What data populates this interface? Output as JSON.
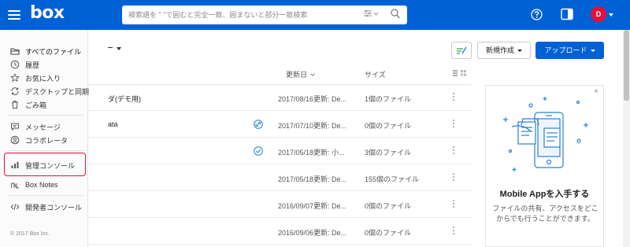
{
  "header": {
    "logo": "box",
    "search_placeholder": "検索語を \" \"で囲むと完全一致、囲まないと部分一致検索",
    "avatar_initial": "D"
  },
  "nav": {
    "items": [
      {
        "label": "すべてのファイル",
        "icon": "folder-icon"
      },
      {
        "label": "履歴",
        "icon": "clock-icon"
      },
      {
        "label": "お気に入り",
        "icon": "star-icon"
      },
      {
        "label": "デスクトップと同期",
        "icon": "sync-icon"
      },
      {
        "label": "ごみ箱",
        "icon": "trash-icon"
      },
      {
        "label": "メッセージ",
        "icon": "message-icon"
      },
      {
        "label": "コラボレータ",
        "icon": "person-icon"
      },
      {
        "label": "管理コンソール",
        "icon": "bar-chart-icon"
      },
      {
        "label": "Box Notes",
        "icon": "notes-icon"
      },
      {
        "label": "開発者コンソール",
        "icon": "code-icon"
      }
    ],
    "copyright": "© 2017 Box Inc."
  },
  "toolbar": {
    "new_label": "新規作成",
    "upload_label": "アップロード"
  },
  "table": {
    "columns": {
      "date": "更新日",
      "size": "サイズ"
    },
    "rows": [
      {
        "name": "ダ(デモ用)",
        "date": "2017/08/16更新: De...",
        "size": "1個のファイル"
      },
      {
        "name": "ata",
        "date": "2017/07/10更新: De...",
        "size": "0個のファイル"
      },
      {
        "name": "",
        "date": "2017/05/18更新: 小...",
        "size": "3個のファイル"
      },
      {
        "name": "",
        "date": "2017/05/18更新: De...",
        "size": "155個のファイル"
      },
      {
        "name": "",
        "date": "2016/09/07更新: De...",
        "size": "0個のファイル"
      },
      {
        "name": "",
        "date": "2016/09/06更新: De...",
        "size": "0個のファイル"
      }
    ]
  },
  "promo": {
    "close": "×",
    "title": "Mobile Appを入手する",
    "description": "ファイルの共有、アクセスをどこからでも行うことができます。"
  },
  "colors": {
    "brand": "#0061d5",
    "highlight": "#e0123d",
    "accent": "#2a7fd4"
  }
}
